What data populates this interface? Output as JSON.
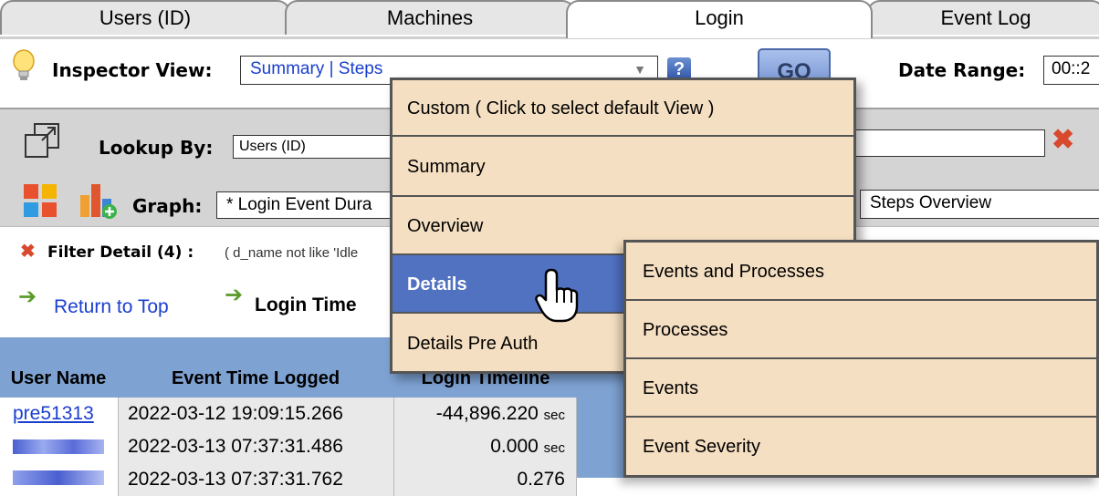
{
  "tabs": [
    {
      "label": "Users (ID)"
    },
    {
      "label": "Machines"
    },
    {
      "label": "Login"
    },
    {
      "label": "Event Log"
    }
  ],
  "inspector": {
    "label": "Inspector View:",
    "value": "Summary | Steps",
    "help": "?",
    "go": "GO",
    "date_range_label": "Date Range:",
    "date_range_value": "00::2"
  },
  "lookup": {
    "label": "Lookup By:",
    "value": "Users (ID)"
  },
  "graph": {
    "label": "Graph:",
    "value": "* Login Event Dura",
    "steps_value": "Steps Overview"
  },
  "filter": {
    "label": "Filter Detail (4) :",
    "text": "( d_name not like 'Idle"
  },
  "nav": {
    "return_top": "Return to Top",
    "login_time": "Login Time"
  },
  "table": {
    "headers": [
      "User Name",
      "Event Time Logged",
      "Login Timeline"
    ],
    "rows": [
      {
        "user": "pre51313",
        "time": "2022-03-12 19:09:15.266",
        "timeline": "-44,896.220",
        "unit": "sec"
      },
      {
        "user": "",
        "time": "2022-03-13 07:37:31.486",
        "timeline": "0.000",
        "unit": "sec"
      },
      {
        "user": "",
        "time": "2022-03-13 07:37:31.762",
        "timeline": "0.276",
        "unit": ""
      }
    ]
  },
  "menu": {
    "items": [
      {
        "label": "Custom ( Click to select default View )"
      },
      {
        "label": "Summary"
      },
      {
        "label": "Overview"
      },
      {
        "label": "Details"
      },
      {
        "label": "Details Pre Auth"
      }
    ]
  },
  "submenu": {
    "items": [
      {
        "label": "Events and Processes"
      },
      {
        "label": "Processes"
      },
      {
        "label": "Events"
      },
      {
        "label": "Event Severity"
      }
    ]
  },
  "colors": {
    "accent": "#5072c0",
    "menu_bg": "#f5dfc2",
    "table_header": "#7ea2d2",
    "link": "#1a3fcf"
  }
}
